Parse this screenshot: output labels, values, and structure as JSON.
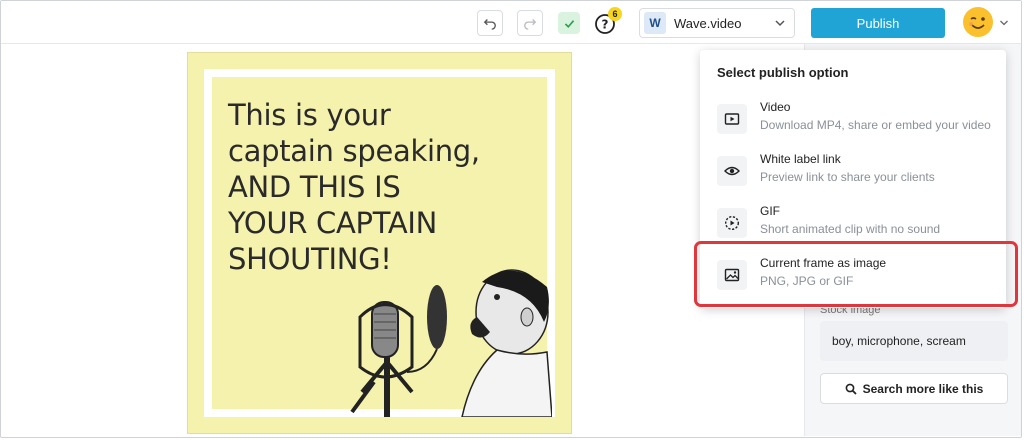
{
  "toolbar": {
    "help_badge_count": "6",
    "workspace_logo_letter": "W",
    "workspace_name": "Wave.video",
    "publish_label": "Publish"
  },
  "canvas": {
    "headline": "This is your\ncaptain speaking,\nAND THIS IS\nYOUR CAPTAIN\nSHOUTING!",
    "background_color": "#f5f2ad"
  },
  "right_panel": {
    "section_label": "Stock image",
    "tags": "boy, microphone, scream",
    "search_more_label": "Search more like this"
  },
  "publish_popup": {
    "title": "Select publish option",
    "options": [
      {
        "icon": "play-icon",
        "title": "Video",
        "description": "Download MP4, share or embed your video"
      },
      {
        "icon": "eye-icon",
        "title": "White label link",
        "description": "Preview link to share your clients"
      },
      {
        "icon": "gif-icon",
        "title": "GIF",
        "description": "Short animated clip with no sound"
      },
      {
        "icon": "image-icon",
        "title": "Current frame as image",
        "description": "PNG, JPG or GIF"
      }
    ]
  },
  "colors": {
    "publish_button": "#20a4d6",
    "highlight": "#e0373d",
    "check_bg": "#d9f3df"
  }
}
